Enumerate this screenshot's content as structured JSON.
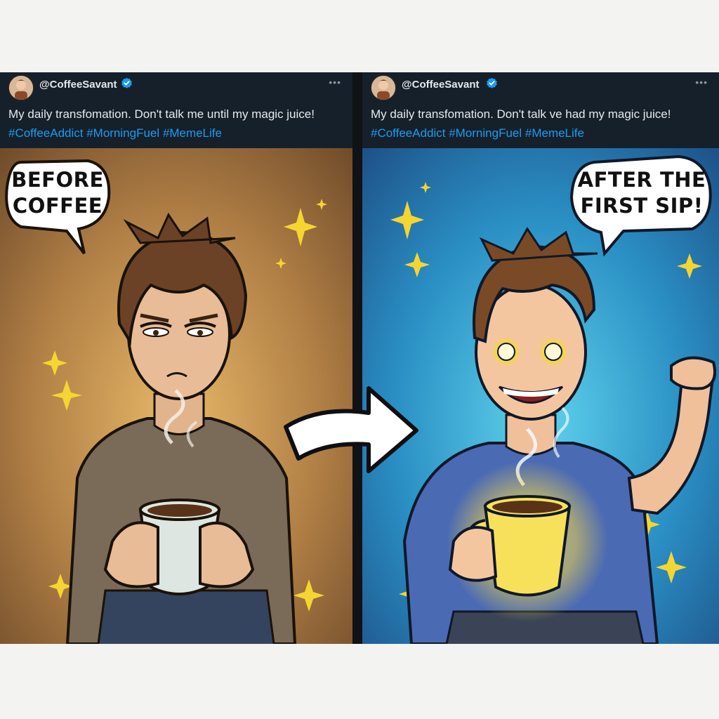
{
  "left_post": {
    "handle": "@CoffeeSavant",
    "more_label": "•••",
    "caption_text": "My daily transfomation. Don't talk me until my magic juice!",
    "hashtags": "#CoffeeAddict #MorningFuel #MemeLife",
    "bubble_line1": "BEFORE",
    "bubble_line2": "COFFEE"
  },
  "right_post": {
    "handle": "@CoffeeSavant",
    "more_label": "•••",
    "caption_text": "My daily transfomation. Don't talk ve had my magic juice!",
    "hashtags": "#CoffeeAddict #MorningFuel #MemeLife",
    "bubble_line1": "AFTER THE",
    "bubble_line2": "FIRST SIP!"
  },
  "icons": {
    "verified": "verified-badge-icon",
    "more": "more-options-icon",
    "arrow": "right-arrow-icon",
    "sparkle": "sparkle-icon"
  },
  "colors": {
    "header_bg": "#15202b",
    "hashtag": "#1d9bf0",
    "left_scene": "#a8783e",
    "right_scene": "#2a8fc4",
    "sparkle": "#f5d531"
  }
}
